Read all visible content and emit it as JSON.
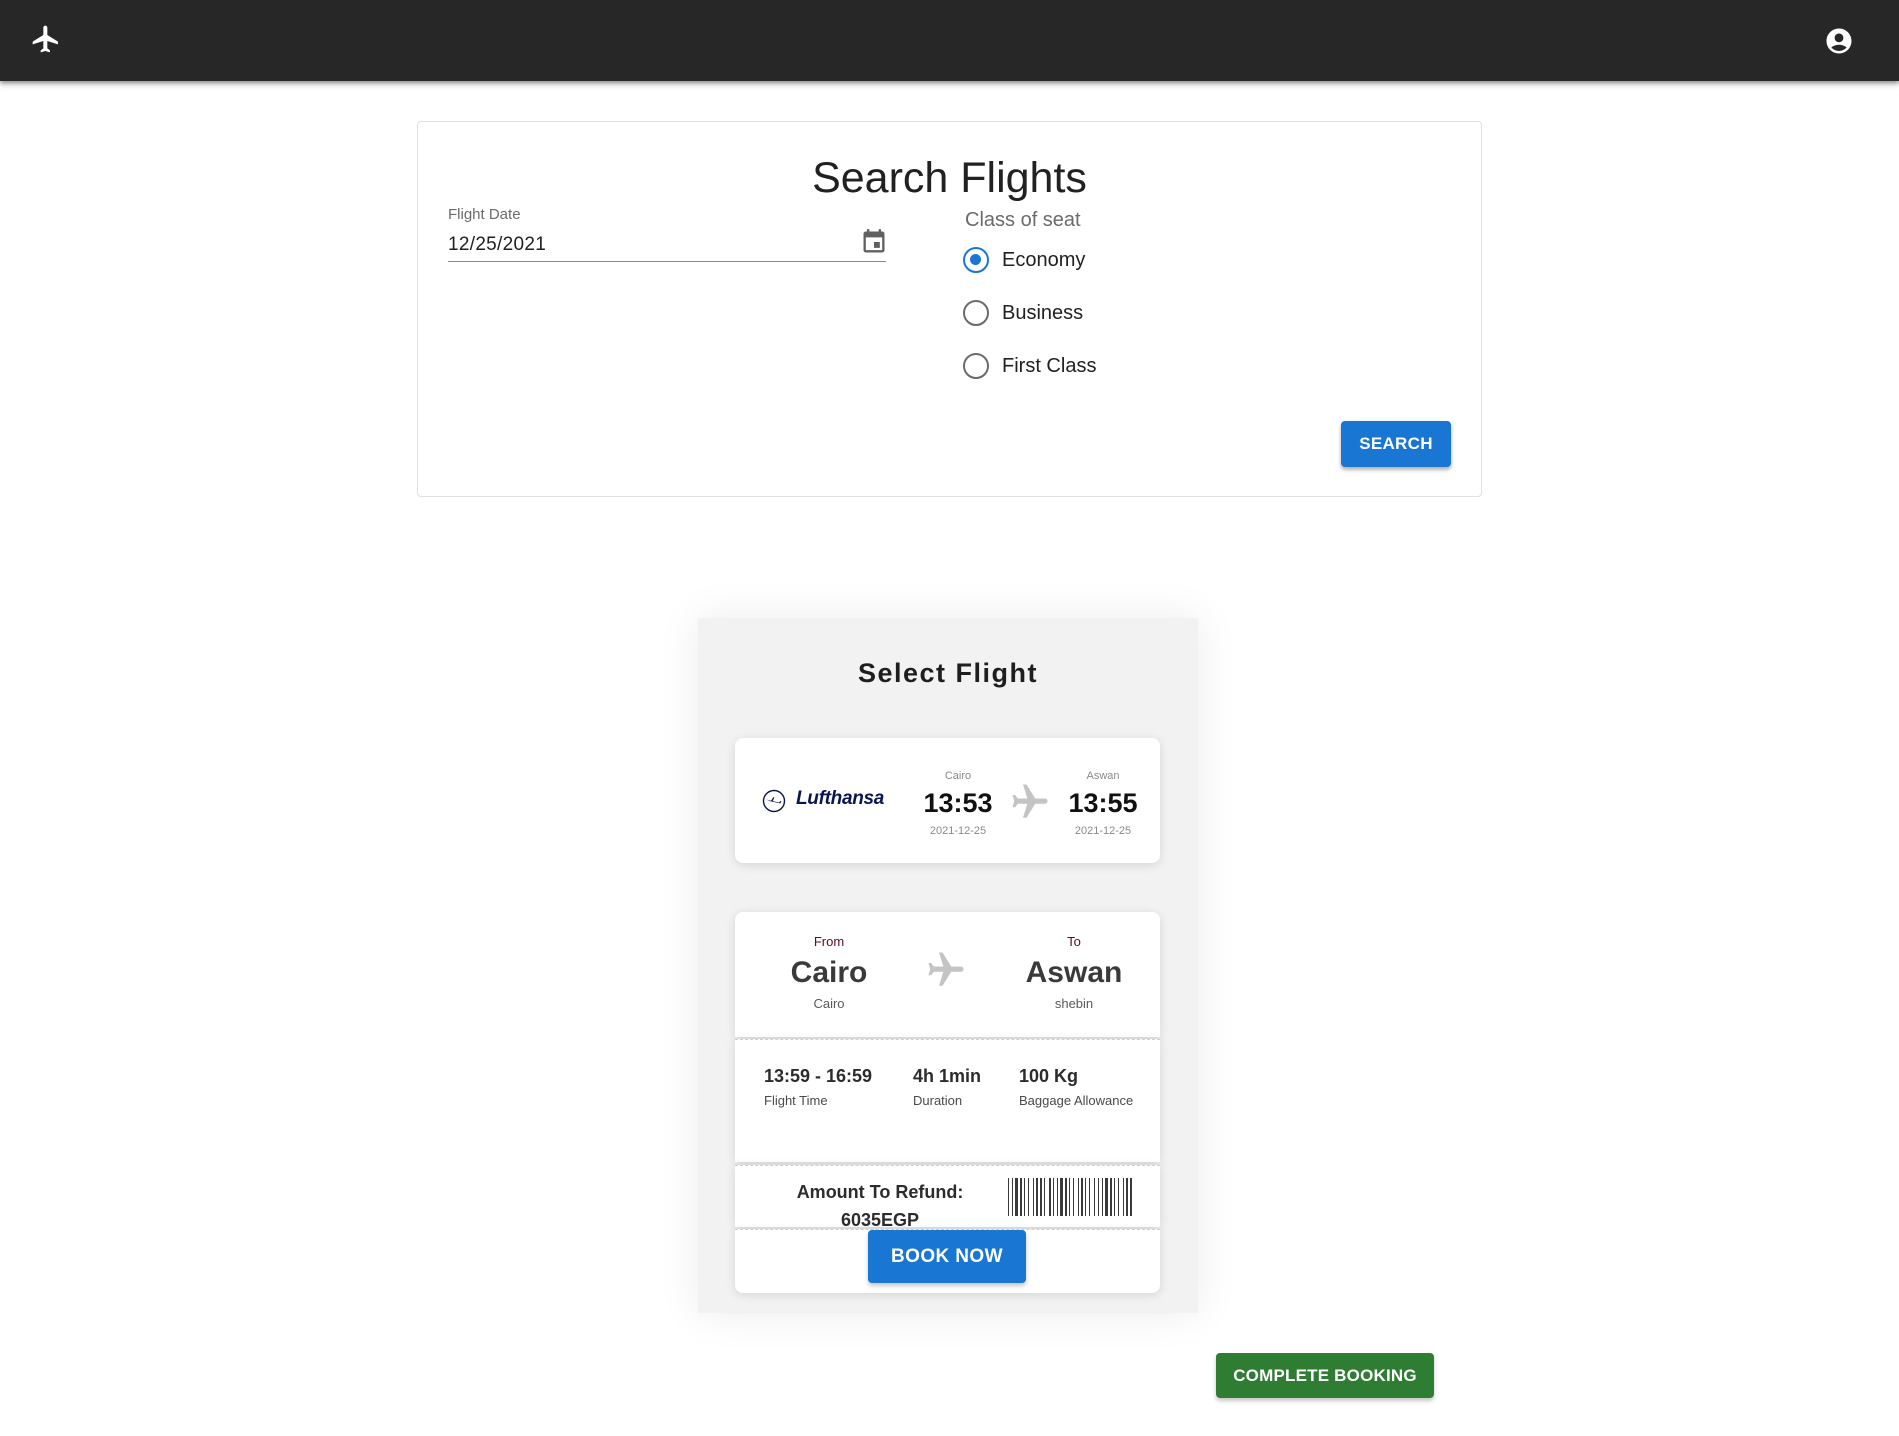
{
  "appbar": {
    "left_icon": "flight-icon",
    "right_icon": "account-circle-icon"
  },
  "search": {
    "title": "Search Flights",
    "date_label": "Flight Date",
    "date_value": "12/25/2021",
    "seat_label": "Class of seat",
    "options": [
      {
        "label": "Economy",
        "selected": true
      },
      {
        "label": "Business",
        "selected": false
      },
      {
        "label": "First Class",
        "selected": false
      }
    ],
    "search_button": "SEARCH"
  },
  "select": {
    "title": "Select Flight",
    "flight": {
      "airline": "Lufthansa",
      "departure": {
        "city": "Cairo",
        "time": "13:53",
        "date": "2021-12-25"
      },
      "arrival": {
        "city": "Aswan",
        "time": "13:55",
        "date": "2021-12-25"
      }
    },
    "ticket": {
      "from_label": "From",
      "from_city": "Cairo",
      "from_sub": "Cairo",
      "to_label": "To",
      "to_city": "Aswan",
      "to_sub": "shebin",
      "flight_time": "13:59 - 16:59",
      "flight_time_label": "Flight Time",
      "duration": "4h 1min",
      "duration_label": "Duration",
      "baggage": "100 Kg",
      "baggage_label": "Baggage Allowance",
      "amount_label": "Amount To Refund:",
      "amount_value": "6035EGP",
      "book_button": "BOOK NOW"
    }
  },
  "complete_button": "COMPLETE BOOKING",
  "colors": {
    "appbar": "#272727",
    "primary": "#1976d2",
    "success": "#2e7d32"
  }
}
